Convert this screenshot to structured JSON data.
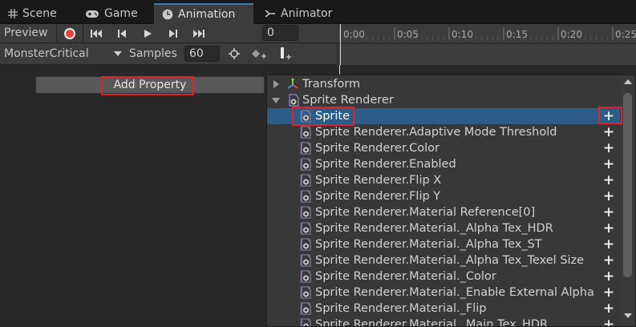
{
  "tabs": [
    {
      "label": "Scene",
      "icon": "grid-icon"
    },
    {
      "label": "Game",
      "icon": "gamepad-icon"
    },
    {
      "label": "Animation",
      "icon": "clock-icon"
    },
    {
      "label": "Animator",
      "icon": "animator-icon"
    }
  ],
  "toolbar": {
    "preview_label": "Preview",
    "frame_value": "0",
    "clip_name": "MonsterCritical",
    "samples_label": "Samples",
    "samples_value": "60"
  },
  "timeline": {
    "ticks": [
      "0:00",
      "0:05",
      "0:10",
      "0:15",
      "0:20",
      "0:25"
    ]
  },
  "add_property_label": "Add Property",
  "property_list": [
    {
      "label": "Transform",
      "type": "group",
      "expanded": false
    },
    {
      "label": "Sprite Renderer",
      "type": "group",
      "expanded": true
    },
    {
      "label": "Sprite",
      "type": "property",
      "selected": true
    },
    {
      "label": "Sprite Renderer.Adaptive Mode Threshold",
      "type": "property"
    },
    {
      "label": "Sprite Renderer.Color",
      "type": "property"
    },
    {
      "label": "Sprite Renderer.Enabled",
      "type": "property"
    },
    {
      "label": "Sprite Renderer.Flip X",
      "type": "property"
    },
    {
      "label": "Sprite Renderer.Flip Y",
      "type": "property"
    },
    {
      "label": "Sprite Renderer.Material Reference[0]",
      "type": "property"
    },
    {
      "label": "Sprite Renderer.Material._Alpha Tex_HDR",
      "type": "property"
    },
    {
      "label": "Sprite Renderer.Material._Alpha Tex_ST",
      "type": "property"
    },
    {
      "label": "Sprite Renderer.Material._Alpha Tex_Texel Size",
      "type": "property"
    },
    {
      "label": "Sprite Renderer.Material._Color",
      "type": "property"
    },
    {
      "label": "Sprite Renderer.Material._Enable External Alpha",
      "type": "property"
    },
    {
      "label": "Sprite Renderer.Material._Flip",
      "type": "property"
    },
    {
      "label": "Sprite Renderer.Material._Main Tex_HDR",
      "type": "property"
    }
  ],
  "colors": {
    "accent": "#3a79bb",
    "selection": "#2c5d87",
    "highlight": "#e0202a",
    "record": "#e8433a"
  }
}
